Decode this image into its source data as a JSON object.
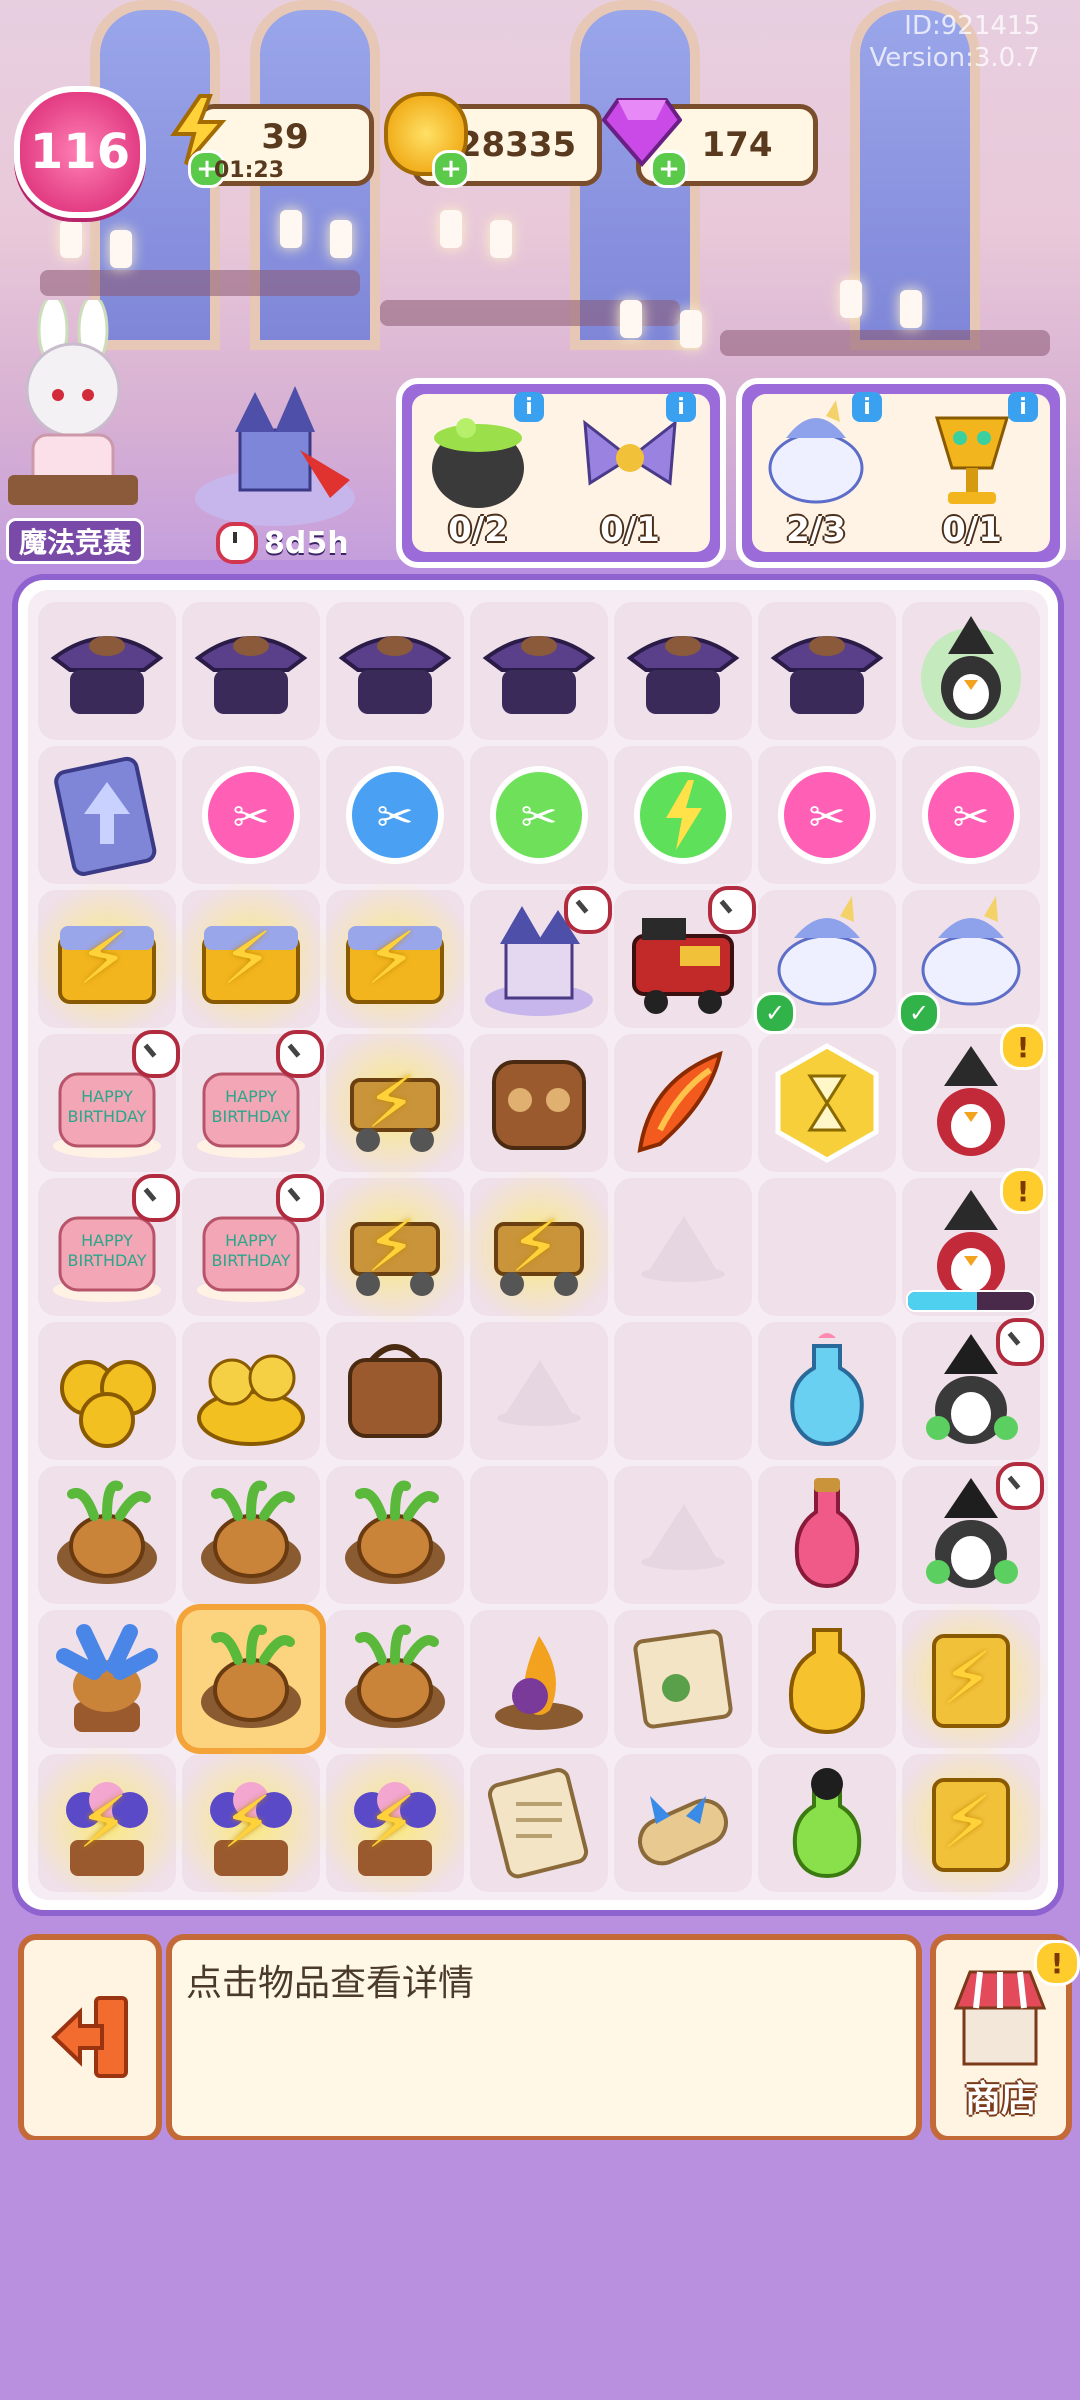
{
  "header": {
    "player_id": "ID:921415",
    "version": "Version:3.0.7",
    "level": "116",
    "energy": "39",
    "energy_timer": "01:23",
    "coins": "28335",
    "gems": "174"
  },
  "event": {
    "label": "魔法竞赛",
    "timer": "8d5h"
  },
  "orders": [
    {
      "icon": "cauldron-icon",
      "count": "0/2"
    },
    {
      "icon": "bow-ribbon-icon",
      "count": "0/1"
    },
    {
      "icon": "unicorn-icon",
      "count": "2/3"
    },
    {
      "icon": "golden-goblet-icon",
      "count": "0/1"
    }
  ],
  "board": {
    "rows": [
      [
        "witch-table",
        "witch-table",
        "witch-table",
        "witch-table",
        "witch-table",
        "witch-table",
        "witch-penguin-green"
      ],
      [
        "upgrade-card",
        "scissors-pink",
        "scissors-blue",
        "scissors-green",
        "energy-orb",
        "scissors-pink",
        "scissors-pink"
      ],
      [
        "locked-chest",
        "locked-chest",
        "locked-chest",
        "castle",
        "train",
        "unicorn",
        "unicorn"
      ],
      [
        "birthday-cake",
        "birthday-cake",
        "locked-cart",
        "owl-bag",
        "phoenix-feather",
        "hourglass-token",
        "witch-penguin-red"
      ],
      [
        "birthday-cake",
        "birthday-cake",
        "locked-cart",
        "locked-cart",
        "empty-hat",
        "empty",
        "witch-penguin-red-progress"
      ],
      [
        "coin-stack",
        "coin-pile",
        "leather-bag",
        "empty-hat",
        "empty",
        "potion-blue",
        "witch-penguin-dark"
      ],
      [
        "mandrake",
        "mandrake",
        "mandrake",
        "empty",
        "empty-hat",
        "potion-pink",
        "witch-penguin-dark"
      ],
      [
        "blue-mandrake",
        "mandrake-selected",
        "mandrake",
        "fire-stone",
        "scroll-map",
        "potion-gold",
        "locked-scroll"
      ],
      [
        "locked-flowers",
        "locked-flowers",
        "locked-flowers",
        "scroll",
        "scroll-bow",
        "potion-green-cat",
        "locked-scroll"
      ]
    ],
    "energy_progress": 0.55
  },
  "bottom": {
    "hint_text": "点击物品查看详情",
    "shop_label": "商店"
  },
  "colors": {
    "background": "#b98fe0",
    "panel_border": "#c46a38",
    "level_badge": "#e33e84",
    "order_panel": "#9b6cd9"
  }
}
